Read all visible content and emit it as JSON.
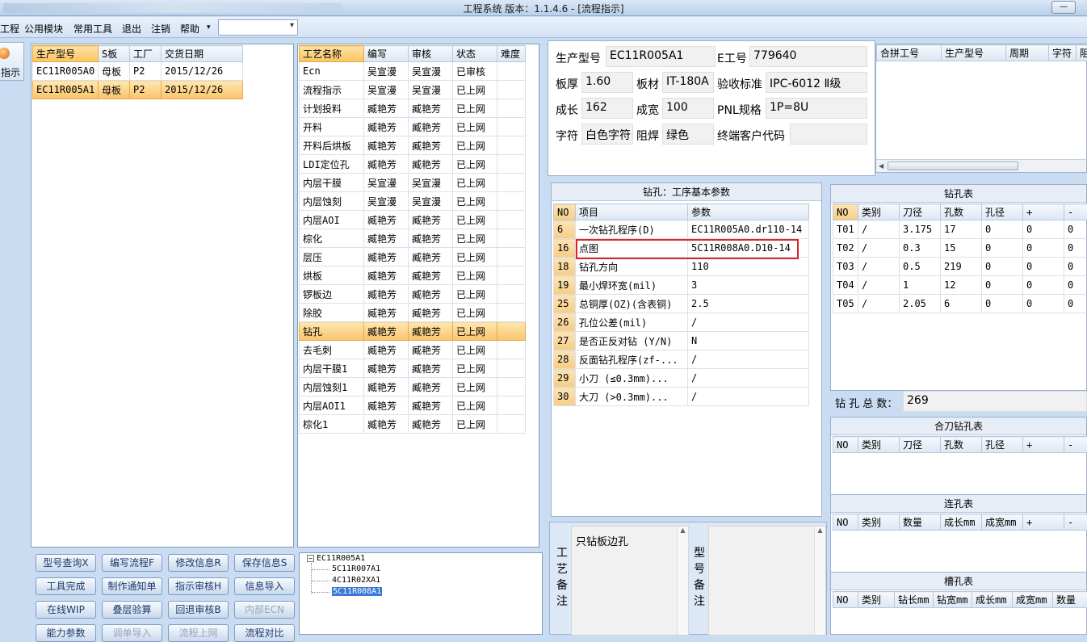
{
  "window": {
    "title": "工程系统   版本：1.1.4.6 - [流程指示]",
    "minimize_label": "—"
  },
  "menu": [
    "工程",
    "公用模块",
    "常用工具",
    "退出",
    "注销",
    "帮助",
    "▾"
  ],
  "left_tab": {
    "label": "指示"
  },
  "model_grid": {
    "headers": [
      "生产型号",
      "S板",
      "工厂",
      "交货日期"
    ],
    "rows": [
      [
        "EC11R005A0",
        "母板",
        "P2",
        "2015/12/26"
      ],
      [
        "EC11R005A1",
        "母板",
        "P2",
        "2015/12/26"
      ]
    ],
    "selected": 1
  },
  "process_grid": {
    "headers": [
      "工艺名称",
      "编写",
      "审核",
      "状态",
      "难度"
    ],
    "rows": [
      [
        "Ecn",
        "吴宣漫",
        "吴宣漫",
        "已审核",
        ""
      ],
      [
        "流程指示",
        "吴宣漫",
        "吴宣漫",
        "已上网",
        ""
      ],
      [
        "计划投料",
        "臧艳芳",
        "臧艳芳",
        "已上网",
        ""
      ],
      [
        "开料",
        "臧艳芳",
        "臧艳芳",
        "已上网",
        ""
      ],
      [
        "开料后烘板",
        "臧艳芳",
        "臧艳芳",
        "已上网",
        ""
      ],
      [
        "LDI定位孔",
        "臧艳芳",
        "臧艳芳",
        "已上网",
        ""
      ],
      [
        "内层干膜",
        "吴宣漫",
        "吴宣漫",
        "已上网",
        ""
      ],
      [
        "内层蚀刻",
        "吴宣漫",
        "吴宣漫",
        "已上网",
        ""
      ],
      [
        "内层AOI",
        "臧艳芳",
        "臧艳芳",
        "已上网",
        ""
      ],
      [
        "棕化",
        "臧艳芳",
        "臧艳芳",
        "已上网",
        ""
      ],
      [
        "层压",
        "臧艳芳",
        "臧艳芳",
        "已上网",
        ""
      ],
      [
        "烘板",
        "臧艳芳",
        "臧艳芳",
        "已上网",
        ""
      ],
      [
        "锣板边",
        "臧艳芳",
        "臧艳芳",
        "已上网",
        ""
      ],
      [
        "除胶",
        "臧艳芳",
        "臧艳芳",
        "已上网",
        ""
      ],
      [
        "钻孔",
        "臧艳芳",
        "臧艳芳",
        "已上网",
        ""
      ],
      [
        "去毛刺",
        "臧艳芳",
        "臧艳芳",
        "已上网",
        ""
      ],
      [
        "内层干膜1",
        "臧艳芳",
        "臧艳芳",
        "已上网",
        ""
      ],
      [
        "内层蚀刻1",
        "臧艳芳",
        "臧艳芳",
        "已上网",
        ""
      ],
      [
        "内层AOI1",
        "臧艳芳",
        "臧艳芳",
        "已上网",
        ""
      ],
      [
        "棕化1",
        "臧艳芳",
        "臧艳芳",
        "已上网",
        ""
      ]
    ],
    "selected": 14
  },
  "buttons": [
    {
      "label": "型号查询X",
      "enabled": true
    },
    {
      "label": "编写流程F",
      "enabled": true
    },
    {
      "label": "修改信息R",
      "enabled": true
    },
    {
      "label": "保存信息S",
      "enabled": true
    },
    {
      "label": "工具完成",
      "enabled": true
    },
    {
      "label": "制作通知单",
      "enabled": true
    },
    {
      "label": "指示审核H",
      "enabled": true
    },
    {
      "label": "信息导入",
      "enabled": true
    },
    {
      "label": "在线WIP",
      "enabled": true
    },
    {
      "label": "叠层验算",
      "enabled": true
    },
    {
      "label": "回退审核B",
      "enabled": true
    },
    {
      "label": "内部ECN",
      "enabled": false
    },
    {
      "label": "能力参数",
      "enabled": true
    },
    {
      "label": "调单导入",
      "enabled": false
    },
    {
      "label": "流程上网",
      "enabled": false
    },
    {
      "label": "流程对比",
      "enabled": true
    }
  ],
  "tree": {
    "root": "EC11R005A1",
    "children": [
      "5C11R007A1",
      "4C11R02XA1",
      "5C11R008A1"
    ],
    "selected": 2
  },
  "info": {
    "model_label": "生产型号",
    "model": "EC11R005A1",
    "eno_label": "E工号",
    "eno": "779640",
    "thickness_label": "板厚",
    "thickness": "1.60",
    "material_label": "板材",
    "material": "IT-180A",
    "standard_label": "验收标准",
    "standard": "IPC-6012 Ⅱ级",
    "length_label": "成长",
    "length": "162",
    "width_label": "成宽",
    "width": "100",
    "pnl_label": "PNL规格",
    "pnl": "1P=8U",
    "char_label": "字符",
    "char": "白色字符",
    "mask_label": "阻焊",
    "mask": "绿色",
    "customer_label": "终端客户代码",
    "customer": ""
  },
  "merge_grid": {
    "headers": [
      "合拼工号",
      "生产型号",
      "周期",
      "字符",
      "阻"
    ]
  },
  "drill_params": {
    "title": "钻孔：工序基本参数",
    "headers": [
      "NO",
      "项目",
      "参数"
    ],
    "rows": [
      [
        "6",
        "一次钻孔程序(D)",
        "EC11R005A0.dr110-14"
      ],
      [
        "16",
        "点图",
        "5C11R008A0.D10-14"
      ],
      [
        "18",
        "钻孔方向",
        "110"
      ],
      [
        "19",
        "最小焊环宽(mil)",
        "3"
      ],
      [
        "25",
        "总铜厚(OZ)(含表铜)",
        "2.5"
      ],
      [
        "26",
        "孔位公差(mil)",
        "/"
      ],
      [
        "27",
        "是否正反对钻 (Y/N)",
        "N"
      ],
      [
        "28",
        "反面钻孔程序(zf-...",
        "/"
      ],
      [
        "29",
        "小刀 (≤0.3mm)...",
        "/"
      ],
      [
        "30",
        "大刀 (>0.3mm)...",
        "/"
      ]
    ],
    "highlight_color": "#d9262b"
  },
  "drill_table": {
    "title": "钻孔表",
    "headers": [
      "NO",
      "类别",
      "刀径",
      "孔数",
      "孔径",
      "+",
      "-"
    ],
    "rows": [
      [
        "T01",
        "/",
        "3.175",
        "17",
        "0",
        "0",
        "0"
      ],
      [
        "T02",
        "/",
        "0.3",
        "15",
        "0",
        "0",
        "0"
      ],
      [
        "T03",
        "/",
        "0.5",
        "219",
        "0",
        "0",
        "0"
      ],
      [
        "T04",
        "/",
        "1",
        "12",
        "0",
        "0",
        "0"
      ],
      [
        "T05",
        "/",
        "2.05",
        "6",
        "0",
        "0",
        "0"
      ]
    ],
    "total_label": "钻 孔 总 数：",
    "total": "269"
  },
  "combo_drill": {
    "title": "合刀钻孔表",
    "headers": [
      "NO",
      "类别",
      "刀径",
      "孔数",
      "孔径",
      "+",
      "-"
    ]
  },
  "link_hole": {
    "title": "连孔表",
    "headers": [
      "NO",
      "类别",
      "数量",
      "成长mm",
      "成宽mm",
      "+",
      "-"
    ]
  },
  "slot_hole": {
    "title": "槽孔表",
    "headers": [
      "NO",
      "类别",
      "钻长mm",
      "钻宽mm",
      "成长mm",
      "成宽mm",
      "数量"
    ]
  },
  "process_note": {
    "label": "工艺备注",
    "text": "只钻板边孔"
  },
  "model_note": {
    "label": "型号备注",
    "text": ""
  }
}
